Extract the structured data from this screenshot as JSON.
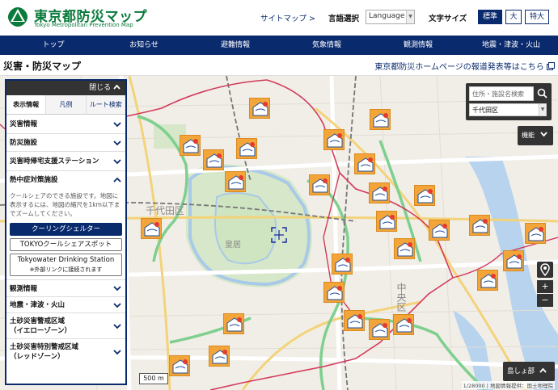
{
  "header": {
    "title": "東京都防災マップ",
    "subtitle": "Tokyo Metropolitan Prevention Map",
    "sitemap": "サイトマップ >",
    "lang_label": "言語選択",
    "lang_value": "Language",
    "fontsize_label": "文字サイズ",
    "fontsize_options": [
      "標準",
      "大",
      "特大"
    ],
    "accent": "#0a2a6e",
    "logo_color": "#0a7a3c"
  },
  "nav": [
    "トップ",
    "お知らせ",
    "避難情報",
    "気象情報",
    "観測情報",
    "地震・津波・火山"
  ],
  "subheader": {
    "page_title": "災害・防災マップ",
    "press_link": "東京都防災ホームページの報道発表等はこちら"
  },
  "panel": {
    "close_label": "閉じる",
    "tabs": [
      "表示情報",
      "凡例",
      "ルート検索"
    ],
    "sections_top": [
      "災害情報",
      "防災施設",
      "災害時帰宅支援ステーション"
    ],
    "open_section": "熱中症対策施設",
    "open_desc": "クールシェアのできる施設です。地図に表示するには、地図の縮尺を1km以下までズームしてください。",
    "buttons": {
      "cooling": "クーリングシェルター",
      "coolshare": "TOKYOクールシェアスポット",
      "tokyowater_1": "Tokyowater Drinking Station",
      "tokyowater_2": "※外部リンクに接続されます"
    },
    "sections_bottom": [
      "観測情報",
      "地震・津波・火山"
    ],
    "yellow_zone_1": "土砂災害警戒区域",
    "yellow_zone_2": "（イエローゾーン）",
    "red_zone_1": "土砂災害特別警戒区域",
    "red_zone_2": "（レッドゾーン）"
  },
  "map": {
    "search_placeholder": "住所・施設名検索",
    "ward_value": "千代田区",
    "function_label": "機能",
    "zoom_in": "+",
    "zoom_out": "−",
    "islands_label": "島しょ部",
    "scale_label": "500 m",
    "attribution": "1/28000 | 地図情報提供：国土地理院",
    "labels": {
      "chiyoda": "千代田区",
      "kokyo": "皇居",
      "chuo": "中央区"
    },
    "marker_color": "#f3a53a"
  }
}
